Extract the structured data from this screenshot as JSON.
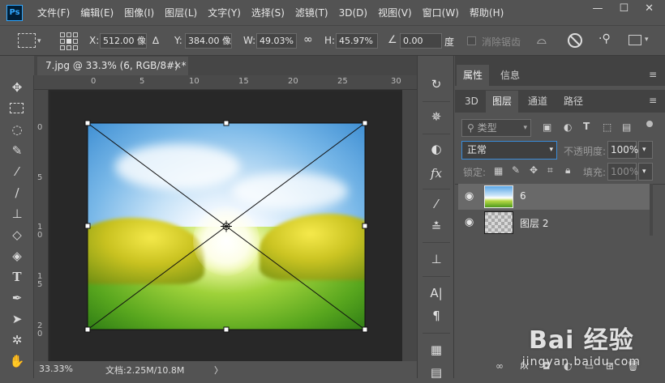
{
  "app": {
    "logo": "Ps",
    "menu": [
      "文件(F)",
      "编辑(E)",
      "图像(I)",
      "图层(L)",
      "文字(Y)",
      "选择(S)",
      "滤镜(T)",
      "3D(D)",
      "视图(V)",
      "窗口(W)",
      "帮助(H)"
    ],
    "window_buttons": {
      "minimize": "—",
      "restore": "☐",
      "close": "✕"
    }
  },
  "options": {
    "x_label": "X:",
    "x_value": "512.00 像素",
    "delta_label": "∆",
    "y_label": "Y:",
    "y_value": "384.00 像素",
    "w_label": "W:",
    "w_value": "49.03%",
    "link_label": "∞",
    "h_label": "H:",
    "h_value": "45.97%",
    "angle_label": "∠",
    "angle_value": "0.00",
    "degree_unit": "度",
    "interpolation_label": "消除锯齿"
  },
  "document": {
    "tab_title": "7.jpg @ 33.3% (6, RGB/8#) *",
    "tab_close": "✕",
    "ruler_top": [
      "0",
      "5",
      "10",
      "15",
      "20",
      "25",
      "30"
    ],
    "ruler_left": [
      "0",
      "5",
      "1\n0",
      "1\n5",
      "2\n0"
    ],
    "zoom": "33.33%",
    "doc_info": "文档:2.25M/10.8M",
    "status_arrow": "〉"
  },
  "panels": {
    "top_tabs": [
      "属性",
      "信息"
    ],
    "layer_tabs": [
      "3D",
      "图层",
      "通道",
      "路径"
    ],
    "filter_kind": "类型",
    "blend_mode": "正常",
    "opacity_label": "不透明度:",
    "opacity_value": "100%",
    "lock_label": "锁定:",
    "fill_label": "填充:",
    "fill_value": "100%",
    "layers": [
      {
        "name": "6",
        "selected": true
      },
      {
        "name": "图层 2",
        "selected": false
      }
    ]
  },
  "watermark": {
    "brand": "Bai 经验",
    "url": "jingyan.baidu.com"
  },
  "colors": {
    "accent_focus": "#3b8bd8",
    "panel_bg": "#535353",
    "dark_bg": "#282828"
  }
}
